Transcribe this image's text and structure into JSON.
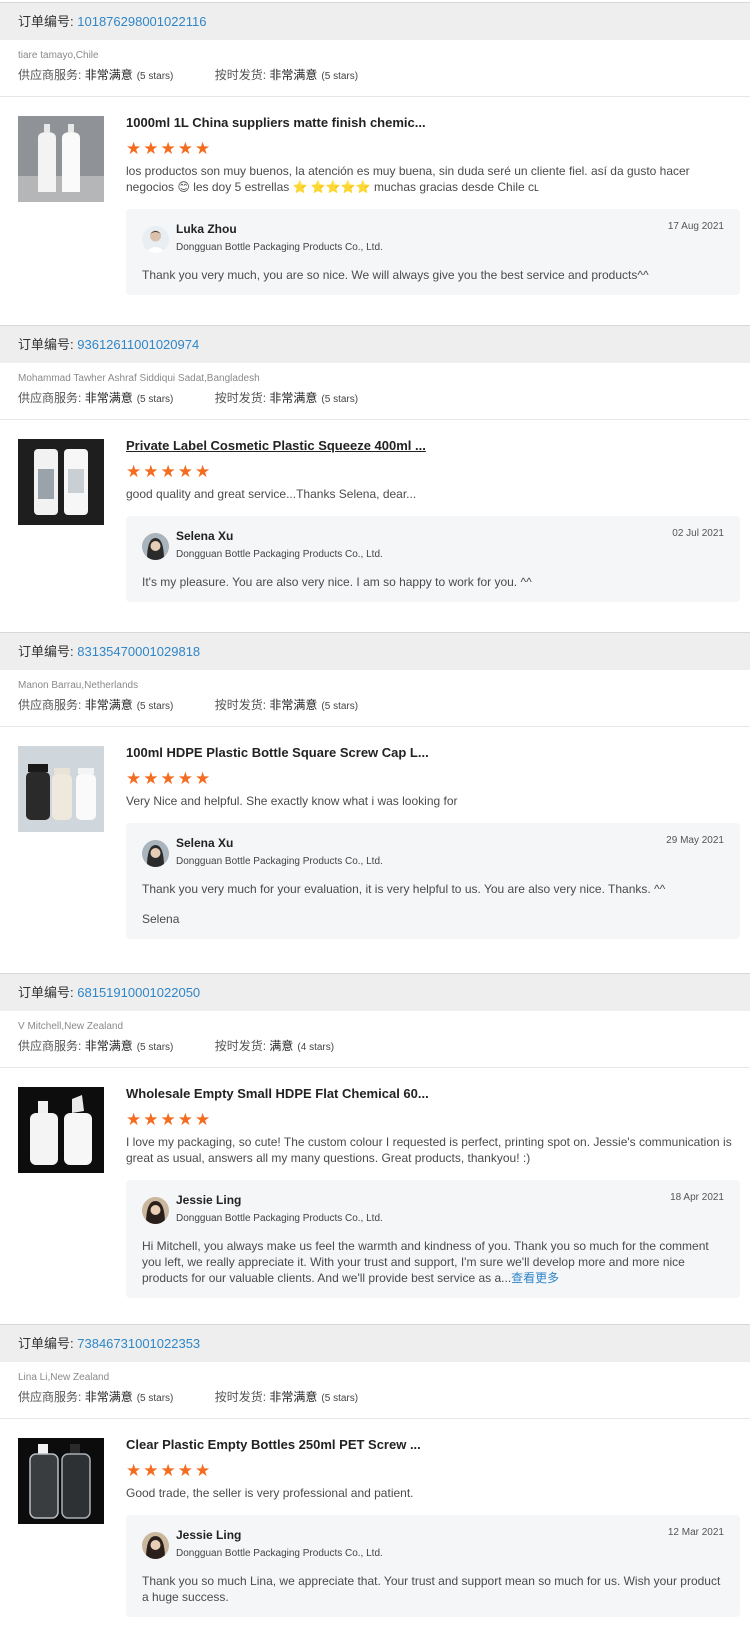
{
  "order_label": "订单编号:",
  "supplier_service_label": "供应商服务:",
  "shipping_label": "按时发货:",
  "reply_company": "Dongguan Bottle Packaging Products Co., Ltd.",
  "colors": {
    "accent_link": "#2f86c8",
    "star_orange": "#f36d21",
    "header_bg": "#eeeeee",
    "reply_bg": "#f5f6f8"
  },
  "reviews": [
    {
      "order_no": "101876298001022116",
      "customer": "tiare tamayo,Chile",
      "service_rating": "非常满意",
      "service_stars": "(5 stars)",
      "shipping_rating": "非常满意",
      "shipping_stars": "(5 stars)",
      "product_title": "1000ml 1L China suppliers matte finish chemic...",
      "star_count": 5,
      "review_text": "los productos son muy buenos, la atención es muy buena, sin duda seré un cliente fiel. así da gusto hacer negocios 😊 les doy 5 estrellas ⭐ ⭐⭐⭐⭐ muchas gracias desde Chile ᴄʟ",
      "reply_name": "Luka Zhou",
      "reply_date": "17 Aug 2021",
      "reply_text": "Thank you very much,  you are so nice. We will always give you the best service and products^^"
    },
    {
      "order_no": "93612611001020974",
      "customer": "Mohammad Tawher Ashraf Siddiqui Sadat,Bangladesh",
      "service_rating": "非常满意",
      "service_stars": "(5 stars)",
      "shipping_rating": "非常满意",
      "shipping_stars": "(5 stars)",
      "product_title": "Private Label Cosmetic Plastic Squeeze 400ml ...",
      "star_count": 5,
      "review_text": "good quality and great service...Thanks Selena, dear...",
      "reply_name": "Selena Xu",
      "reply_date": "02 Jul 2021",
      "reply_text": "It's my pleasure. You are also very nice. I am so happy to work for you. ^^"
    },
    {
      "order_no": "83135470001029818",
      "customer": "Manon Barrau,Netherlands",
      "service_rating": "非常满意",
      "service_stars": "(5 stars)",
      "shipping_rating": "非常满意",
      "shipping_stars": "(5 stars)",
      "product_title": "100ml HDPE Plastic Bottle Square Screw Cap L...",
      "star_count": 5,
      "review_text": "Very Nice and helpful. She exactly know what i was looking for",
      "reply_name": "Selena Xu",
      "reply_date": "29 May 2021",
      "reply_text": "Thank you very much for your evaluation, it is very helpful to us. You are also very nice. Thanks. ^^",
      "reply_sign": "Selena"
    },
    {
      "order_no": "68151910001022050",
      "customer": "V Mitchell,New Zealand",
      "service_rating": "非常满意",
      "service_stars": "(5 stars)",
      "shipping_rating": "满意",
      "shipping_stars": "(4 stars)",
      "product_title": "Wholesale Empty Small HDPE Flat Chemical 60...",
      "star_count": 5,
      "review_text": "I love my packaging, so cute! The custom colour I requested is perfect, printing spot on. Jessie's communication is great as usual, answers all my many questions. Great products, thankyou! :)",
      "reply_name": "Jessie Ling",
      "reply_date": "18 Apr 2021",
      "reply_text": "Hi Mitchell, you always make us feel the warmth and kindness of you. Thank you so much for the comment you left, we really appreciate it. With your trust and support, I'm sure we'll develop more and more nice products for our valuable clients. And we'll  provide best service as a...",
      "reply_more": "查看更多"
    },
    {
      "order_no": "73846731001022353",
      "customer": "Lina Li,New Zealand",
      "service_rating": "非常满意",
      "service_stars": "(5 stars)",
      "shipping_rating": "非常满意",
      "shipping_stars": "(5 stars)",
      "product_title": "Clear Plastic Empty Bottles 250ml PET Screw ...",
      "star_count": 5,
      "review_text": "Good trade, the seller is very professional and patient.",
      "reply_name": "Jessie Ling",
      "reply_date": "12 Mar 2021",
      "reply_text": "Thank you so much Lina, we appreciate that. Your trust and support mean so much for us. Wish your product a huge success."
    }
  ]
}
